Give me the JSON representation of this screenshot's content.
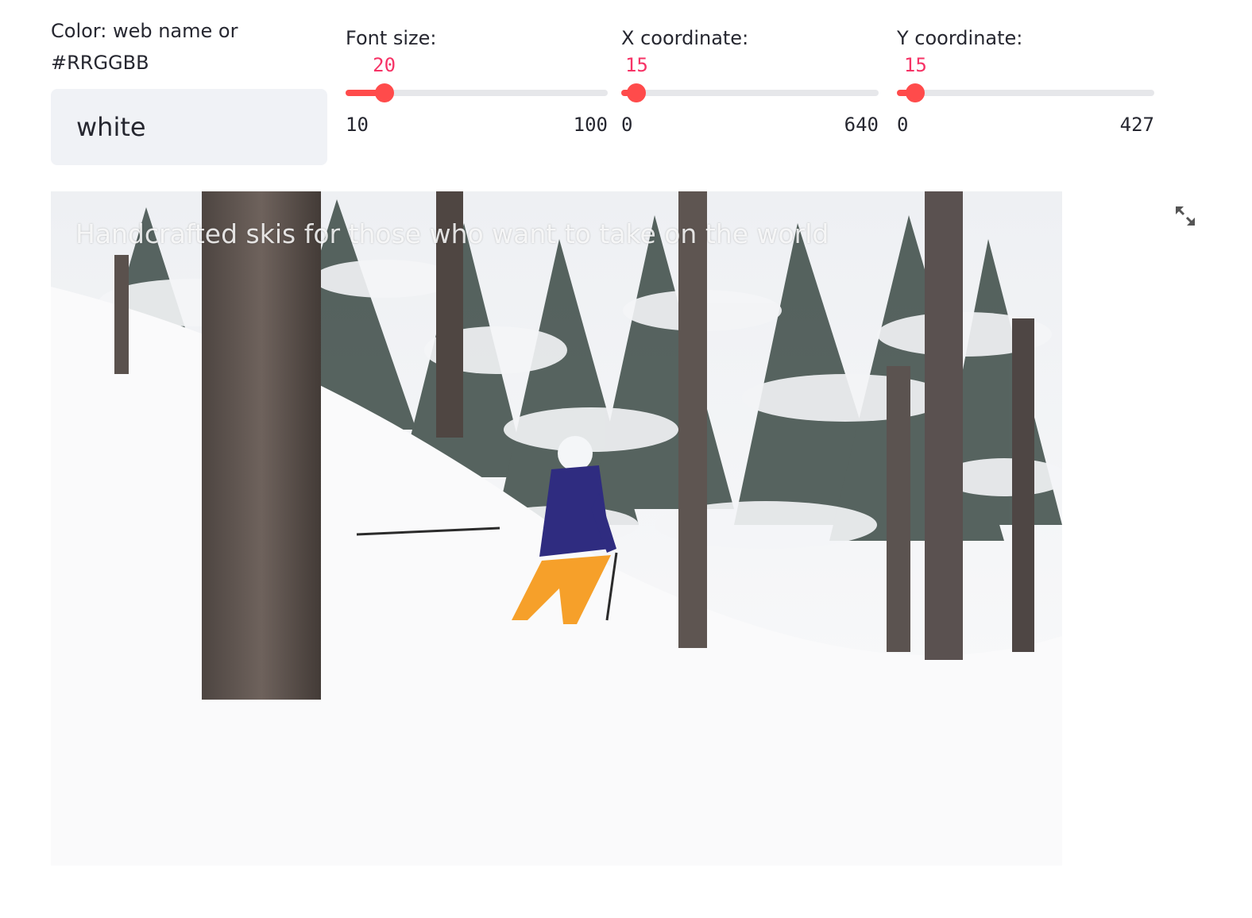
{
  "color_input": {
    "label": "Color: web name or #RRGGBB",
    "value": "white"
  },
  "sliders": [
    {
      "label": "Font size:",
      "value": "20",
      "min": "10",
      "max": "100",
      "fraction": 0.111
    },
    {
      "label": "X coordinate:",
      "value": "15",
      "min": "0",
      "max": "640",
      "fraction": 0.023
    },
    {
      "label": "Y coordinate:",
      "value": "15",
      "min": "0",
      "max": "427",
      "fraction": 0.035
    }
  ],
  "image": {
    "caption": "Handcrafted skis for those who want to take on the world"
  },
  "icons": {
    "fullscreen": "expand-icon"
  },
  "colors": {
    "accent": "#ff4b4b",
    "slider_value": "#f63366",
    "input_bg": "#f0f2f6"
  }
}
